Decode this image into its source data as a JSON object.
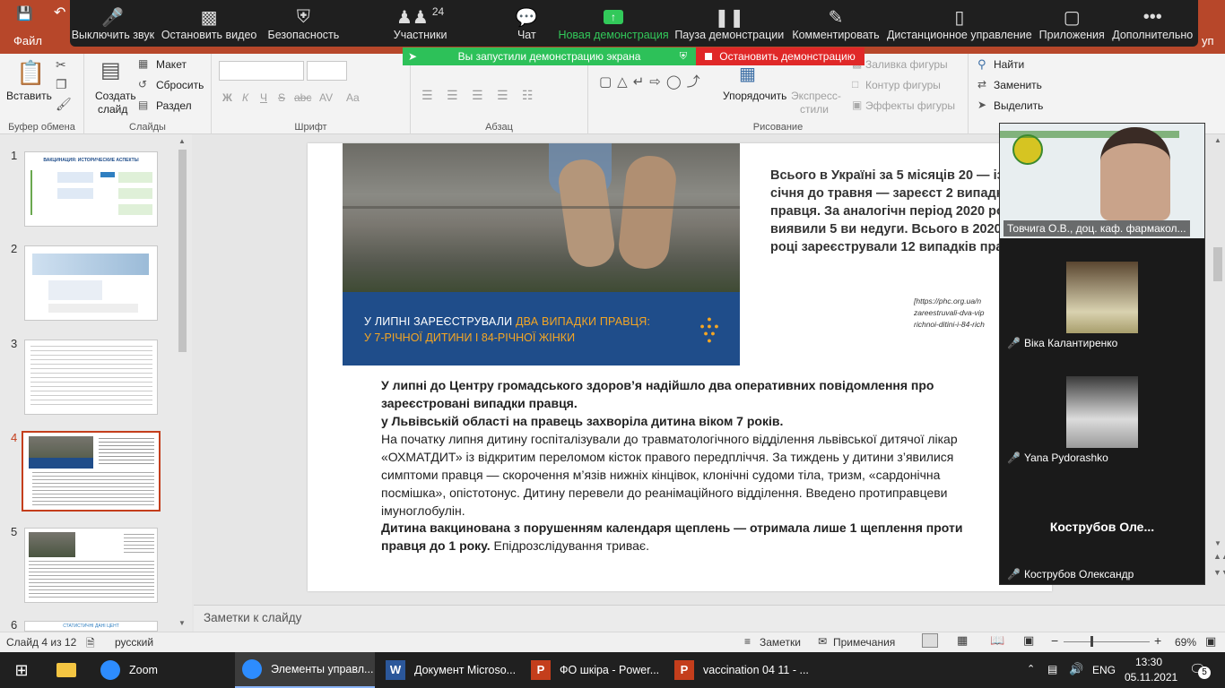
{
  "window": {
    "menu_file": "Файл",
    "menu_tail": "уп"
  },
  "zoom_toolbar": {
    "mute": "Выключить звук",
    "stop_video": "Остановить видео",
    "security": "Безопасность",
    "participants": "Участники",
    "participants_count": "24",
    "chat": "Чат",
    "new_share": "Новая демонстрация",
    "pause_share": "Пауза демонстрации",
    "annotate": "Комментировать",
    "remote_control": "Дистанционное управление",
    "apps": "Приложения",
    "more": "Дополнительно"
  },
  "share_banner": {
    "started": "Вы запустили демонстрацию экрана",
    "stop": "Остановить демонстрацию"
  },
  "ribbon": {
    "clipboard": {
      "paste": "Вставить",
      "label": "Буфер обмена"
    },
    "slides": {
      "new_slide_1": "Создать",
      "new_slide_2": "слайд",
      "layout": "Макет",
      "reset": "Сбросить",
      "section": "Раздел",
      "label": "Слайды"
    },
    "font": {
      "bold": "Ж",
      "italic": "К",
      "underline": "Ч",
      "strike": "S",
      "shadow": "abc",
      "spacing": "AV",
      "case": "Aa",
      "label": "Шрифт"
    },
    "paragraph": {
      "label": "Абзац"
    },
    "drawing": {
      "arrange": "Упорядочить",
      "quick_styles_1": "Экспресс-",
      "quick_styles_2": "стили",
      "fill": "Заливка фигуры",
      "outline": "Контур фигуры",
      "effects": "Эффекты фигуры",
      "label": "Рисование"
    },
    "editing": {
      "find": "Найти",
      "replace": "Заменить",
      "select": "Выделить"
    }
  },
  "slides_panel": {
    "numbers": [
      "1",
      "2",
      "3",
      "4",
      "5",
      "6"
    ],
    "selected": "4",
    "thumb1_title": "ВАКЦИНАЦИЯ: ИСТОРИЧЕСКИЕ АСПЕКТЫ",
    "thumb6_title": "СТАТИСТИЧНІ ДАНІ ЦЕНТ"
  },
  "slide": {
    "right_text": "Всього в Україні за 5 місяців 20 — із січня до травня — зареєст 2 випадки правця. За аналогічн період 2020 року виявили 5 ви недуги. Всього в 2020 році зареєстрували 12 випадків пра",
    "source": "[https://phc.org.ua/n zareestruvali-dva-vip richnoi-ditini-i-84-rich",
    "banner_line1_a": "У ЛИПНІ ЗАРЕЄСТРУВАЛИ ",
    "banner_line1_b": "ДВА ВИПАДКИ ПРАВЦЯ:",
    "banner_line2": "У 7-РІЧНОЇ ДИТИНИ І 84-РІЧНОЇ ЖІНКИ",
    "para1": "У липні до Центру громадського здоров’я надійшло два оперативних повідомлення про зареєстровані випадки правця.",
    "para2": " у Львівській області на правець захворіла дитина віком 7 років.",
    "para3": "На початку липня дитину госпіталізували до травматологічного відділення львівської дитячої лікар «ОХМАТДИТ» із відкритим переломом кісток правого передпліччя. За тиждень у дитини з’явилися симптоми правця — скорочення м’язів нижніх кінцівок, клонічні судоми тіла, тризм, «сардонічна посмішка», опістотонус. Дитину перевели до реанімаційного відділення. Введено протиправцеви імуноглобулін.",
    "para4_bold": "Дитина вакцинована з порушенням календаря щеплень — отримала лише 1 щеплення проти правця до 1 року.",
    "para4_rest": " Епідрозслідування триває."
  },
  "notes_placeholder": "Заметки к слайду",
  "video_panel": {
    "p1": "Товчига О.В., доц. каф. фармакол...",
    "p2": "Віка Калантиренко",
    "p3": "Yana Pydorashko",
    "p4_big": "Коструб​ов  Оле...",
    "p4": "Кострубов Олександр"
  },
  "status": {
    "slide": "Слайд 4 из 12",
    "lang": "русский",
    "notes": "Заметки",
    "comments": "Примечания",
    "zoom": "69%"
  },
  "taskbar": {
    "zoom": "Zoom",
    "zoom_controls": "Элементы управл...",
    "word": "Документ Microso...",
    "ppt1": "ФО шкіра - Power...",
    "ppt2": "vaccination 04 11 - ...",
    "lang": "ENG",
    "time": "13:30",
    "date": "05.11.2021",
    "badge": "5"
  },
  "colors": {
    "accent": "#b7472a",
    "zoom_green": "#2dc159",
    "stop_red": "#e02828",
    "banner_blue": "#1f4d8a"
  }
}
